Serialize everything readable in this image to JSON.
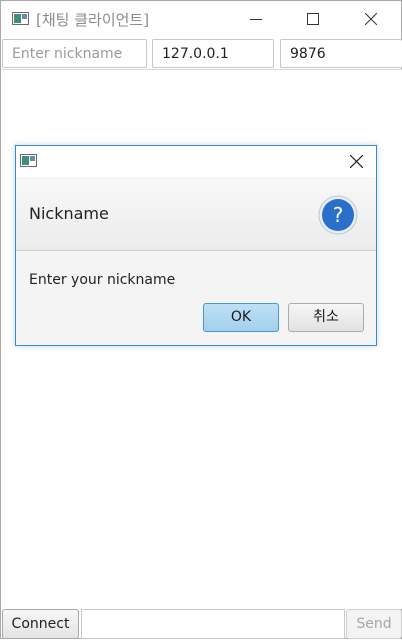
{
  "window": {
    "title": "[채팅 클라이언트]"
  },
  "connection": {
    "nickname_placeholder": "Enter nickname",
    "nickname_value": "",
    "host_value": "127.0.0.1",
    "port_value": "9876"
  },
  "bottom": {
    "connect_label": "Connect",
    "message_value": "",
    "send_label": "Send"
  },
  "dialog": {
    "header_title": "Nickname",
    "content_text": "Enter your nickname",
    "ok_label": "OK",
    "cancel_label": "취소",
    "help_glyph": "?"
  },
  "colors": {
    "accent": "#2f8ed8",
    "help_icon": "#2a6fc9",
    "ok_button": "#a4d0ee"
  }
}
